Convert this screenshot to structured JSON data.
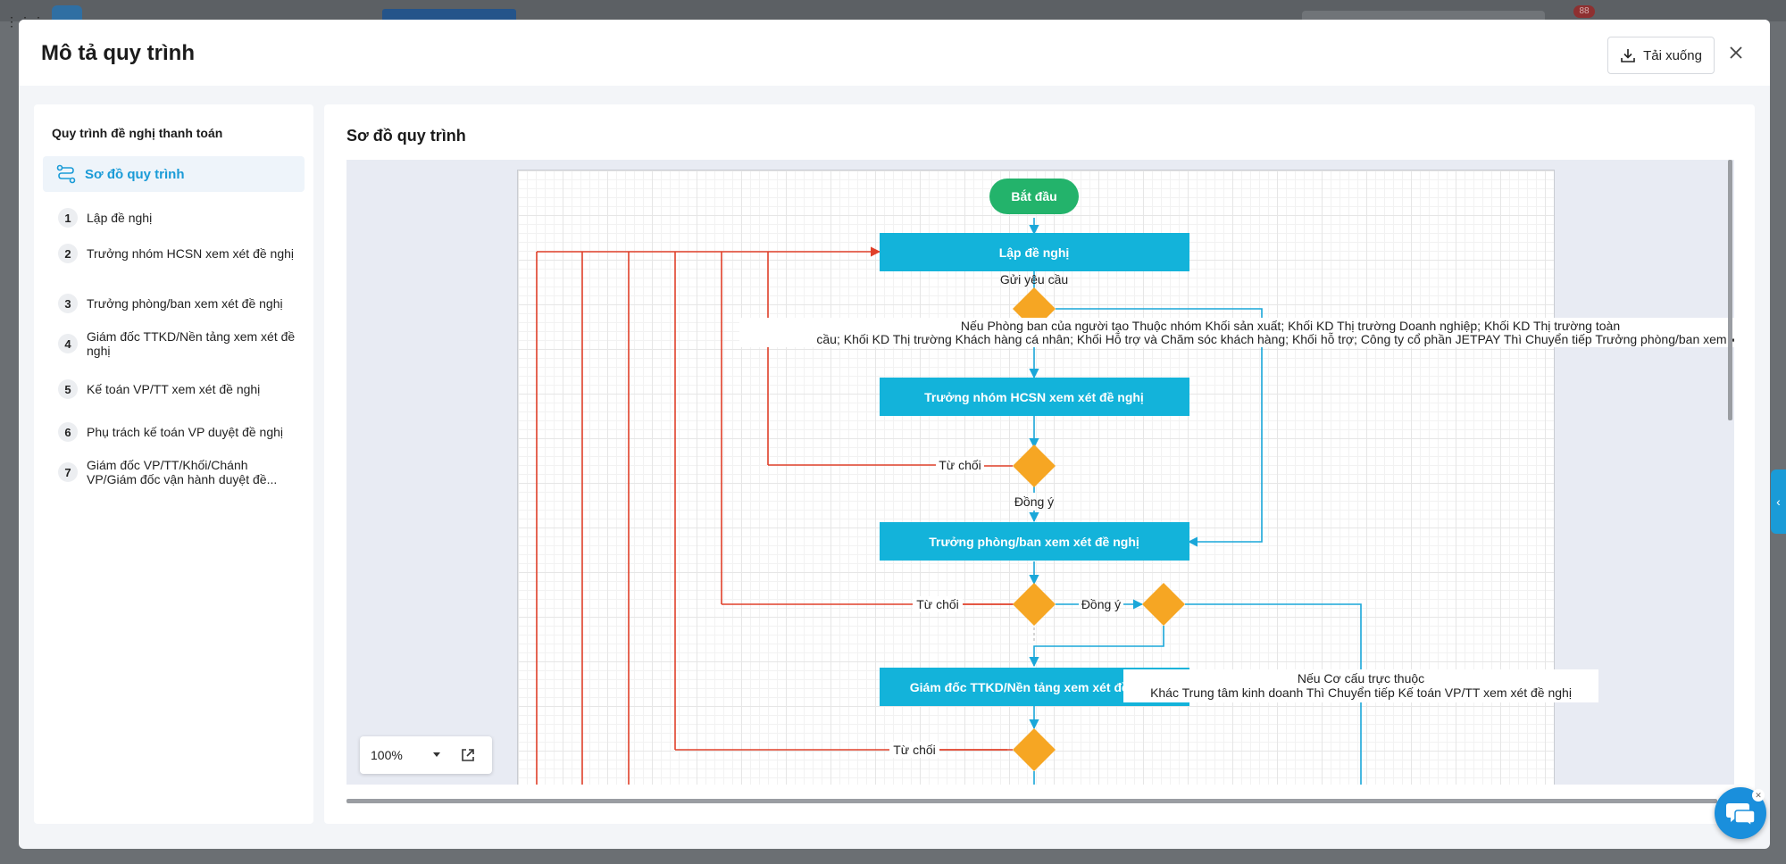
{
  "modal": {
    "title": "Mô tả quy trình",
    "download_label": "Tải xuống"
  },
  "sidebar": {
    "title": "Quy trình đề nghị thanh toán",
    "active_item": "Sơ đồ quy trình",
    "steps": [
      {
        "num": "1",
        "label": "Lập đề nghị"
      },
      {
        "num": "2",
        "label": "Trưởng nhóm HCSN xem xét đề nghị"
      },
      {
        "num": "3",
        "label": "Trưởng phòng/ban xem xét đề nghị"
      },
      {
        "num": "4",
        "label": "Giám đốc TTKD/Nền tảng xem xét đề nghị"
      },
      {
        "num": "5",
        "label": "Kế toán VP/TT xem xét đề nghị"
      },
      {
        "num": "6",
        "label": "Phụ trách kế toán VP duyệt đề nghị"
      },
      {
        "num": "7",
        "label": "Giám đốc VP/TT/Khối/Chánh VP/Giám đốc vận hành duyệt đề..."
      }
    ]
  },
  "main": {
    "title": "Sơ đồ quy trình",
    "zoom": "100%"
  },
  "diagram": {
    "start": "Bắt đầu",
    "node_1": "Lập đề nghị",
    "send_label": "Gửi yêu cầu",
    "condition_1_line1": "Nếu Phòng ban của người tạo Thuộc nhóm Khối sản xuất; Khối KD Thị trường Doanh nghiệp; Khối KD Thị trường toàn",
    "condition_1_line2": "cầu; Khối KD Thị trường Khách hàng cá nhân; Khối Hỗ trợ và Chăm sóc khách hàng; Khối hỗ trợ; Công ty cổ phần JETPAY Thì Chuyển tiếp Trưởng phòng/ban xem xét đề",
    "node_2": "Trưởng nhóm HCSN xem xét đề nghị",
    "reject": "Từ chối",
    "approve": "Đồng ý",
    "node_3": "Trưởng phòng/ban xem xét đề nghị",
    "node_4": "Giám đốc TTKD/Nền tảng xem xét đề nghị",
    "condition_2_line1": "Nếu Cơ cấu trực thuộc",
    "condition_2_line2": "Khác Trung tâm kinh doanh Thì Chuyển tiếp Kế toán VP/TT xem xét đề nghị"
  },
  "topbar": {
    "badge": "88"
  },
  "colors": {
    "accent": "#1a9bd7",
    "node": "#13b3da",
    "start": "#23b36b",
    "decision": "#f6a623",
    "reject_line": "#e0402a",
    "approve_line": "#1aa7d9"
  }
}
